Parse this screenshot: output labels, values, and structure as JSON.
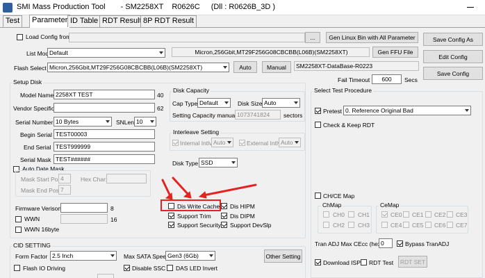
{
  "window": {
    "title": [
      "SMI Mass Production Tool",
      "- SM2258XT",
      "R0626C",
      "(Dll : R0626B_3D )"
    ]
  },
  "tabs": [
    "Test",
    "Parameter",
    "ID Table",
    "RDT Result",
    "8P RDT Result"
  ],
  "top": {
    "load_config": "Load Config from",
    "load_btn": "...",
    "gen_linux_btn": "Gen Linux Bin with All Parameter",
    "list_mode": "List Mode",
    "list_mode_val": "Default",
    "flash_info": "Micron,256Gbit,MT29F256G08CBCBB(L06B)(SM2258XT)",
    "gen_ffu_btn": "Gen FFU File",
    "flash_select": "Flash Select",
    "flash_select_val": "Micron,256Gbit,MT29F256G08CBCBB(L06B)(SM2258XT)",
    "auto_btn": "Auto",
    "manual_btn": "Manual",
    "database": "SM2258XT-DataBase-R0223",
    "fail_timeout": "Fail Timeout",
    "fail_timeout_val": "600",
    "secs": "Secs",
    "save_config_as": "Save Config As",
    "edit_config": "Edit Config",
    "save_config": "Save Config"
  },
  "setup": {
    "legend": "Setup Disk",
    "model_name": "Model Name",
    "model_name_val": "2258XT TEST",
    "model_len": "40",
    "vendor": "Vendor Specific",
    "vendor_len": "62",
    "serial_number": "Serial Number",
    "sn_val": "10 Bytes",
    "snlen": "SNLen",
    "snlen_val": "10",
    "begin_serial": "Begin Serial",
    "begin_val": "TEST00003",
    "end_serial": "End Serial",
    "end_val": "TEST999999",
    "serial_mask": "Serial Mask",
    "mask_val": "TEST######",
    "auto_date": "Auto Date Mask",
    "mask_start": "Mask Start Pos",
    "mask_start_val": "4",
    "hex_char": "Hex Char:",
    "mask_end": "Mask End Pos",
    "mask_end_val": "7",
    "fw_version": "Firmware Verison",
    "fw_len": "8",
    "wwn": "WWN",
    "wwn_len": "16",
    "wwn16": "WWN 16byte"
  },
  "capacity": {
    "legend": "Disk Capacity",
    "cap_type": "Cap Type",
    "cap_type_val": "Default",
    "disk_size": "Disk Size",
    "disk_size_val": "Auto",
    "setting_manual": "Setting Capacity manually",
    "sectors_val": "1073741824",
    "sectors": "sectors"
  },
  "interleave": {
    "legend": "Interleave Setting",
    "internal": "Internal Intlv",
    "internal_val": "Auto",
    "external": "External Intlv",
    "external_val": "Auto"
  },
  "disk_type": {
    "label": "Disk Type",
    "val": "SSD"
  },
  "features": {
    "write_cache": "Dis Write Cache",
    "hipm": "Dis HIPM",
    "trim": "Support Trim",
    "dipm": "Dis DIPM",
    "security": "Support Security",
    "devslp": "Support DevSlp"
  },
  "cid": {
    "legend": "CID SETTING",
    "form_factor": "Form Factor",
    "form_factor_val": "2.5 Inch",
    "max_sata": "Max SATA Speed",
    "max_sata_val": "Gen3 (6Gb)",
    "other_btn": "Other Setting",
    "flash_io": "Flash IO Driving",
    "disable_ssc": "Disable SSC",
    "das_led": "DAS LED Invert"
  },
  "test_proc": {
    "legend": "Select Test Procedure",
    "pretest": "Pretest",
    "pretest_val": "0. Reference Original Bad",
    "check_keep": "Check & Keep RDT",
    "chce_map": "CH/CE Map",
    "chmap": "ChMap",
    "cemap": "CeMap",
    "ch": [
      "CH0",
      "CH1",
      "CH2",
      "CH3"
    ],
    "ce": [
      "CE0",
      "CE1",
      "CE2",
      "CE3",
      "CE4",
      "CE5",
      "CE6",
      "CE7"
    ],
    "tran_adj": "Tran ADJ Max CEcc (hex)",
    "tran_adj_val": "0",
    "bypass": "Bypass TranADJ",
    "download_isp": "Download ISP",
    "rdt_test": "RDT Test",
    "rdt_set": "RDT SET"
  }
}
